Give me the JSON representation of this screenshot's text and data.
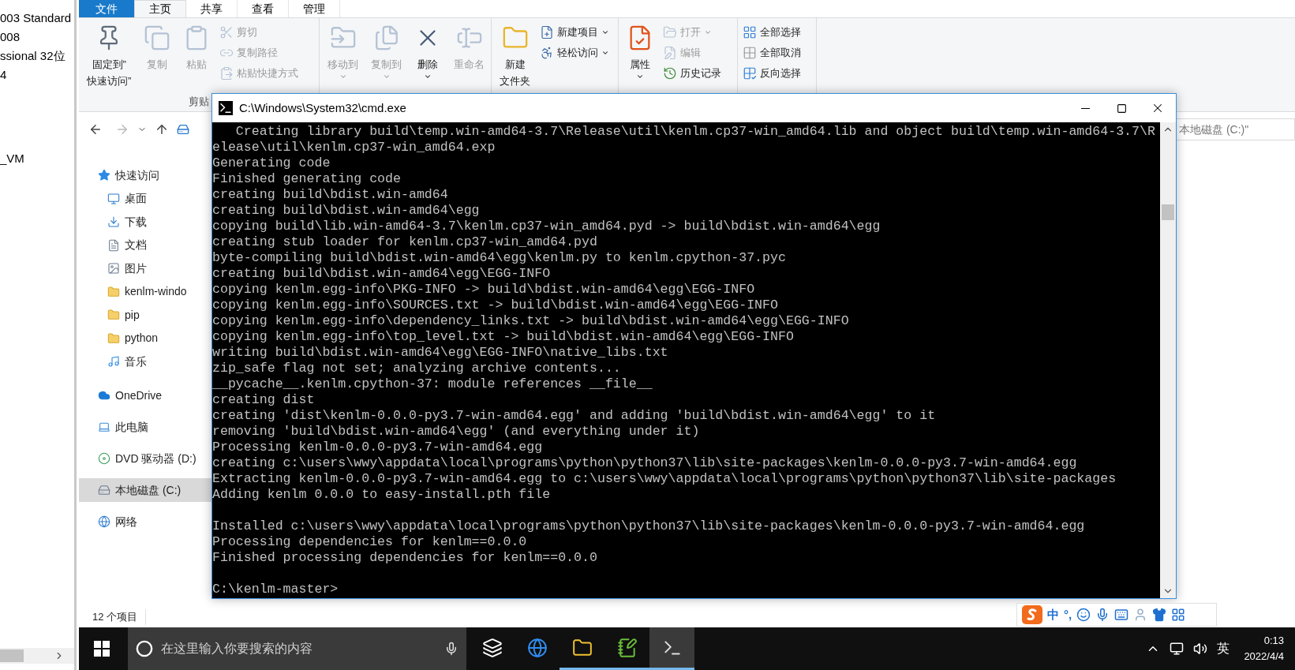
{
  "background_window": {
    "blocks": [
      {
        "lines": [
          "003 Standard",
          "008",
          "ssional 32位",
          "4"
        ]
      },
      {
        "lines": [
          "_VM"
        ]
      }
    ]
  },
  "explorer": {
    "file_menu": {
      "label": "文件"
    },
    "tabs": [
      {
        "label": "主页",
        "selected": true
      },
      {
        "label": "共享",
        "selected": false
      },
      {
        "label": "查看",
        "selected": false
      },
      {
        "label": "管理",
        "selected": false
      }
    ],
    "ribbon": {
      "groups": [
        {
          "label": "剪贴",
          "items": [
            {
              "kind": "pin",
              "lines": [
                "固定到”",
                "快速访问”"
              ],
              "disabled": false,
              "dropdown": false
            },
            {
              "kind": "copy",
              "lines": [
                "复制"
              ],
              "disabled": true,
              "dropdown": false
            },
            {
              "kind": "paste",
              "lines": [
                "粘贴"
              ],
              "disabled": true,
              "dropdown": false
            },
            {
              "kind": "cut",
              "lines": [
                "剪切"
              ],
              "disabled": true,
              "dropdown": false
            },
            {
              "kind": "copy_path",
              "lines": [
                "复制路径"
              ],
              "disabled": true,
              "dropdown": false
            },
            {
              "kind": "paste_shortcut",
              "lines": [
                "粘贴快捷方式"
              ],
              "disabled": true,
              "dropdown": false
            }
          ]
        },
        {
          "items": [
            {
              "kind": "move_to",
              "lines": [
                "移动到"
              ],
              "disabled": true,
              "dropdown": true
            },
            {
              "kind": "copy_to",
              "lines": [
                "复制到"
              ],
              "disabled": true,
              "dropdown": true
            },
            {
              "kind": "delete",
              "lines": [
                "删除"
              ],
              "disabled": false,
              "dropdown": true
            },
            {
              "kind": "rename",
              "lines": [
                "重命名"
              ],
              "disabled": true,
              "dropdown": false
            }
          ]
        },
        {
          "items": [
            {
              "kind": "new_folder",
              "lines": [
                "新建",
                "文件夹"
              ],
              "disabled": false,
              "dropdown": false
            },
            {
              "kind": "new_item",
              "lines": [
                "新建项目"
              ],
              "disabled": false,
              "dropdown": true
            },
            {
              "kind": "easy_access",
              "lines": [
                "轻松访问"
              ],
              "disabled": false,
              "dropdown": true
            }
          ]
        },
        {
          "items": [
            {
              "kind": "properties",
              "lines": [
                "属性"
              ],
              "disabled": false,
              "dropdown": true
            },
            {
              "kind": "open",
              "lines": [
                "打开"
              ],
              "disabled": true,
              "dropdown": true
            },
            {
              "kind": "edit",
              "lines": [
                "编辑"
              ],
              "disabled": true,
              "dropdown": false
            },
            {
              "kind": "history",
              "lines": [
                "历史记录"
              ],
              "disabled": false,
              "dropdown": false
            }
          ]
        },
        {
          "items": [
            {
              "kind": "select_all",
              "lines": [
                "全部选择"
              ],
              "disabled": false,
              "dropdown": false
            },
            {
              "kind": "select_none",
              "lines": [
                "全部取消"
              ],
              "disabled": false,
              "dropdown": false
            },
            {
              "kind": "invert",
              "lines": [
                "反向选择"
              ],
              "disabled": false,
              "dropdown": false
            }
          ]
        }
      ]
    },
    "search": {
      "placeholder": "本地磁盘 (C:)\""
    },
    "nav": [
      {
        "label": "快速访问",
        "kind": "star",
        "selected": false,
        "children": [
          {
            "label": "桌面",
            "kind": "desktop",
            "selected": false
          },
          {
            "label": "下载",
            "kind": "download",
            "selected": false
          },
          {
            "label": "文档",
            "kind": "document",
            "selected": false
          },
          {
            "label": "图片",
            "kind": "picture",
            "selected": false
          },
          {
            "label": "kenlm-windo",
            "kind": "folder",
            "selected": false
          },
          {
            "label": "pip",
            "kind": "folder",
            "selected": false
          },
          {
            "label": "python",
            "kind": "folder",
            "selected": false
          },
          {
            "label": "音乐",
            "kind": "music",
            "selected": false
          }
        ]
      },
      {
        "label": "OneDrive",
        "kind": "cloud",
        "selected": false
      },
      {
        "label": "此电脑",
        "kind": "pc",
        "selected": false
      },
      {
        "label": "DVD 驱动器 (D:)",
        "kind": "dvd",
        "selected": false
      },
      {
        "label": "本地磁盘 (C:)",
        "kind": "drive",
        "selected": true
      },
      {
        "label": "网络",
        "kind": "network",
        "selected": false
      }
    ],
    "status_bar": {
      "item_count": "12 个项目"
    }
  },
  "console": {
    "title": "C:\\Windows\\System32\\cmd.exe",
    "blocks": [
      {
        "lines": [
          "   Creating library build\\temp.win-amd64-3.7\\Release\\util\\kenlm.cp37-win_amd64.lib and object build\\temp.win-amd64-3.7\\R",
          "elease\\util\\kenlm.cp37-win_amd64.exp",
          "Generating code",
          "Finished generating code",
          "creating build\\bdist.win-amd64",
          "creating build\\bdist.win-amd64\\egg",
          "copying build\\lib.win-amd64-3.7\\kenlm.cp37-win_amd64.pyd -> build\\bdist.win-amd64\\egg",
          "creating stub loader for kenlm.cp37-win_amd64.pyd",
          "byte-compiling build\\bdist.win-amd64\\egg\\kenlm.py to kenlm.cpython-37.pyc",
          "creating build\\bdist.win-amd64\\egg\\EGG-INFO",
          "copying kenlm.egg-info\\PKG-INFO -> build\\bdist.win-amd64\\egg\\EGG-INFO",
          "copying kenlm.egg-info\\SOURCES.txt -> build\\bdist.win-amd64\\egg\\EGG-INFO",
          "copying kenlm.egg-info\\dependency_links.txt -> build\\bdist.win-amd64\\egg\\EGG-INFO",
          "copying kenlm.egg-info\\top_level.txt -> build\\bdist.win-amd64\\egg\\EGG-INFO",
          "writing build\\bdist.win-amd64\\egg\\EGG-INFO\\native_libs.txt",
          "zip_safe flag not set; analyzing archive contents...",
          "__pycache__.kenlm.cpython-37: module references __file__",
          "creating dist",
          "creating 'dist\\kenlm-0.0.0-py3.7-win-amd64.egg' and adding 'build\\bdist.win-amd64\\egg' to it",
          "removing 'build\\bdist.win-amd64\\egg' (and everything under it)",
          "Processing kenlm-0.0.0-py3.7-win-amd64.egg",
          "creating c:\\users\\wwy\\appdata\\local\\programs\\python\\python37\\lib\\site-packages\\kenlm-0.0.0-py3.7-win-amd64.egg",
          "Extracting kenlm-0.0.0-py3.7-win-amd64.egg to c:\\users\\wwy\\appdata\\local\\programs\\python\\python37\\lib\\site-packages",
          "Adding kenlm 0.0.0 to easy-install.pth file"
        ]
      },
      {
        "lines": [
          "Installed c:\\users\\wwy\\appdata\\local\\programs\\python\\python37\\lib\\site-packages\\kenlm-0.0.0-py3.7-win-amd64.egg",
          "Processing dependencies for kenlm==0.0.0",
          "Finished processing dependencies for kenlm==0.0.0"
        ]
      },
      {
        "lines": [
          "C:\\kenlm-master>"
        ]
      }
    ]
  },
  "taskbar": {
    "search": {
      "placeholder": "在这里输入你要搜索的内容"
    },
    "apps": [
      {
        "kind": "task_view",
        "open": false,
        "active": false
      },
      {
        "kind": "browser",
        "open": false,
        "active": false
      },
      {
        "kind": "explorer",
        "open": true,
        "active": false
      },
      {
        "kind": "notepad",
        "open": true,
        "active": false
      },
      {
        "kind": "terminal",
        "open": true,
        "active": true
      }
    ],
    "tray": {
      "input_language": "英",
      "time": "0:13",
      "date": "2022/4/4"
    }
  },
  "ime_toolbar": {
    "mode": "中",
    "punctuation": "°,"
  }
}
